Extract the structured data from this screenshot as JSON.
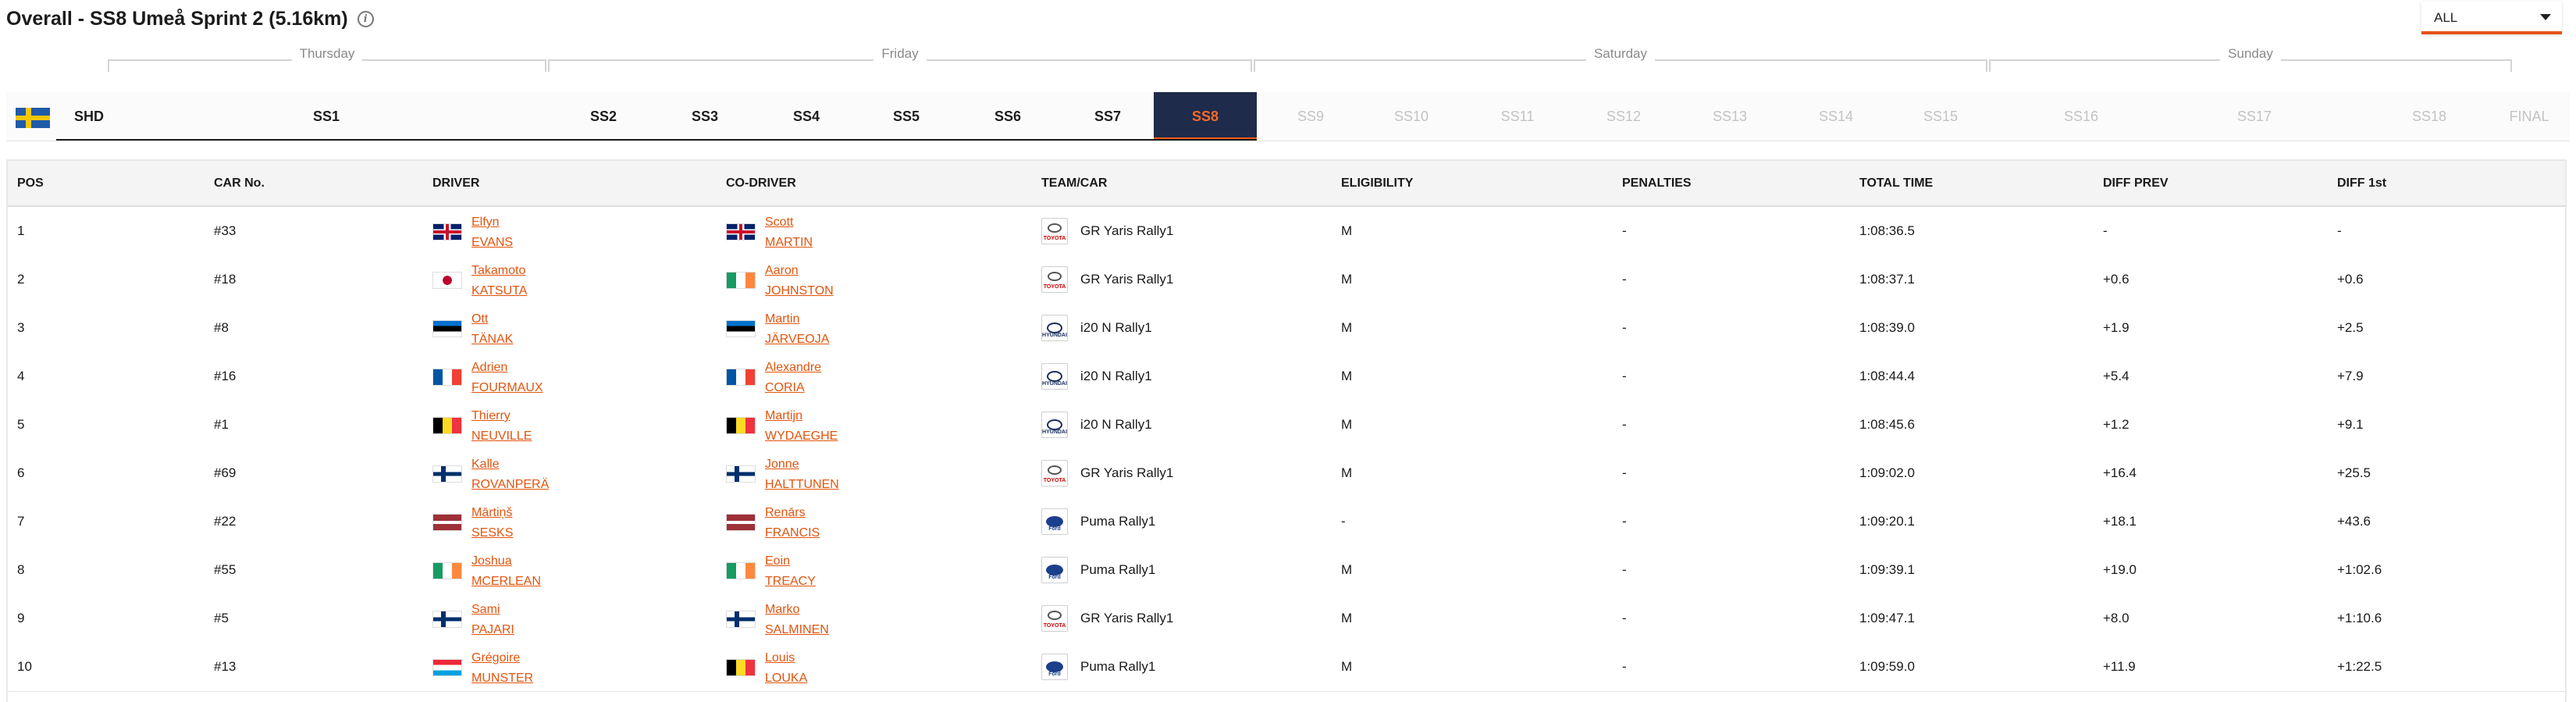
{
  "header": {
    "title": "Overall - SS8 Umeå Sprint 2 (5.16km)",
    "info_icon": "info-icon",
    "filter_value": "ALL"
  },
  "days": [
    "Thursday",
    "Friday",
    "Saturday",
    "Sunday"
  ],
  "stages": {
    "country_flag": "sweden-flag",
    "shakedown": "SHD",
    "items": [
      "SS1",
      "SS2",
      "SS3",
      "SS4",
      "SS5",
      "SS6",
      "SS7",
      "SS8",
      "SS9",
      "SS10",
      "SS11",
      "SS12",
      "SS13",
      "SS14",
      "SS15",
      "SS16",
      "SS17",
      "SS18",
      "FINAL"
    ],
    "active": "SS8"
  },
  "table": {
    "columns": [
      "POS",
      "CAR No.",
      "DRIVER",
      "CO-DRIVER",
      "TEAM/CAR",
      "ELIGIBILITY",
      "PENALTIES",
      "TOTAL TIME",
      "DIFF PREV",
      "DIFF 1st"
    ],
    "rows": [
      {
        "pos": "1",
        "car": "#33",
        "flag": "gb",
        "driver_first": "Elfyn",
        "driver_last": "EVANS",
        "co_flag": "gb",
        "co_first": "Scott",
        "co_last": "MARTIN",
        "brand": "toyota",
        "team": "GR Yaris Rally1",
        "elig": "M",
        "pen": "-",
        "total": "1:08:36.5",
        "diff_prev": "-",
        "diff_first": "-"
      },
      {
        "pos": "2",
        "car": "#18",
        "flag": "jp",
        "driver_first": "Takamoto",
        "driver_last": "KATSUTA",
        "co_flag": "ie",
        "co_first": "Aaron",
        "co_last": "JOHNSTON",
        "brand": "toyota",
        "team": "GR Yaris Rally1",
        "elig": "M",
        "pen": "-",
        "total": "1:08:37.1",
        "diff_prev": "+0.6",
        "diff_first": "+0.6"
      },
      {
        "pos": "3",
        "car": "#8",
        "flag": "ee",
        "driver_first": "Ott",
        "driver_last": "TÄNAK",
        "co_flag": "ee",
        "co_first": "Martin",
        "co_last": "JÄRVEOJA",
        "brand": "hyundai",
        "team": "i20 N Rally1",
        "elig": "M",
        "pen": "-",
        "total": "1:08:39.0",
        "diff_prev": "+1.9",
        "diff_first": "+2.5"
      },
      {
        "pos": "4",
        "car": "#16",
        "flag": "fr",
        "driver_first": "Adrien",
        "driver_last": "FOURMAUX",
        "co_flag": "fr",
        "co_first": "Alexandre",
        "co_last": "CORIA",
        "brand": "hyundai",
        "team": "i20 N Rally1",
        "elig": "M",
        "pen": "-",
        "total": "1:08:44.4",
        "diff_prev": "+5.4",
        "diff_first": "+7.9"
      },
      {
        "pos": "5",
        "car": "#1",
        "flag": "be",
        "driver_first": "Thierry",
        "driver_last": "NEUVILLE",
        "co_flag": "be",
        "co_first": "Martijn",
        "co_last": "WYDAEGHE",
        "brand": "hyundai",
        "team": "i20 N Rally1",
        "elig": "M",
        "pen": "-",
        "total": "1:08:45.6",
        "diff_prev": "+1.2",
        "diff_first": "+9.1"
      },
      {
        "pos": "6",
        "car": "#69",
        "flag": "fi",
        "driver_first": "Kalle",
        "driver_last": "ROVANPERÄ",
        "co_flag": "fi",
        "co_first": "Jonne",
        "co_last": "HALTTUNEN",
        "brand": "toyota",
        "team": "GR Yaris Rally1",
        "elig": "M",
        "pen": "-",
        "total": "1:09:02.0",
        "diff_prev": "+16.4",
        "diff_first": "+25.5"
      },
      {
        "pos": "7",
        "car": "#22",
        "flag": "lv",
        "driver_first": "Mārtiņš",
        "driver_last": "SESKS",
        "co_flag": "lv",
        "co_first": "Renārs",
        "co_last": "FRANCIS",
        "brand": "ford",
        "team": "Puma Rally1",
        "elig": "-",
        "pen": "-",
        "total": "1:09:20.1",
        "diff_prev": "+18.1",
        "diff_first": "+43.6"
      },
      {
        "pos": "8",
        "car": "#55",
        "flag": "ie",
        "driver_first": "Joshua",
        "driver_last": "MCERLEAN",
        "co_flag": "ie",
        "co_first": "Eoin",
        "co_last": "TREACY",
        "brand": "ford",
        "team": "Puma Rally1",
        "elig": "M",
        "pen": "-",
        "total": "1:09:39.1",
        "diff_prev": "+19.0",
        "diff_first": "+1:02.6"
      },
      {
        "pos": "9",
        "car": "#5",
        "flag": "fi",
        "driver_first": "Sami",
        "driver_last": "PAJARI",
        "co_flag": "fi",
        "co_first": "Marko",
        "co_last": "SALMINEN",
        "brand": "toyota",
        "team": "GR Yaris Rally1",
        "elig": "M",
        "pen": "-",
        "total": "1:09:47.1",
        "diff_prev": "+8.0",
        "diff_first": "+1:10.6"
      },
      {
        "pos": "10",
        "car": "#13",
        "flag": "lu",
        "driver_first": "Grégoire",
        "driver_last": "MUNSTER",
        "co_flag": "be",
        "co_first": "Louis",
        "co_last": "LOUKA",
        "brand": "ford",
        "team": "Puma Rally1",
        "elig": "M",
        "pen": "-",
        "total": "1:09:59.0",
        "diff_prev": "+11.9",
        "diff_first": "+1:22.5"
      }
    ]
  },
  "brand_labels": {
    "toyota": "TOYOTA",
    "hyundai": "HYUNDAI",
    "ford": "Ford"
  },
  "colors": {
    "accent": "#e5531a",
    "link": "#e2550f",
    "active_tab_bg": "#1e2b4a",
    "active_tab_text": "#ff6a23"
  }
}
